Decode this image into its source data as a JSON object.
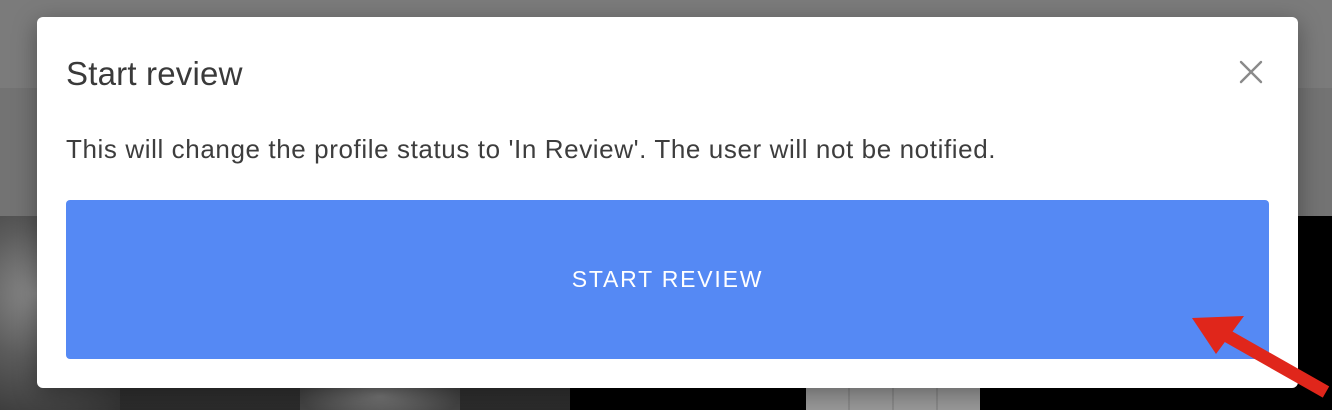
{
  "modal": {
    "title": "Start review",
    "message": "This will change the profile status to 'In Review'. The user will not be notified.",
    "primary_button_label": "START REVIEW",
    "close_icon": "close-icon"
  },
  "colors": {
    "primary_button": "#5589f4",
    "backdrop": "#6f6f6f",
    "annotation_arrow": "#e0261b"
  }
}
